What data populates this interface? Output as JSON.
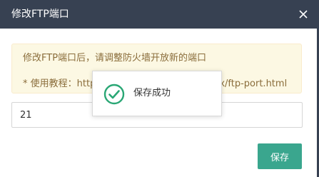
{
  "dialog": {
    "title": "修改FTP端口",
    "close_icon": "close-icon",
    "colors": {
      "titlebar_bg": "#374152",
      "notice_bg": "#fcf8e3",
      "notice_text": "#8a6d3b",
      "accent": "#3aa68e"
    }
  },
  "notice": {
    "line1": "修改FTP端口后，请调整防火墙开放新的端口",
    "line2_prefix": "* 使用教程：http",
    "line2_suffix": "x/ftp-port.html"
  },
  "form": {
    "port_value": "21"
  },
  "footer": {
    "save_label": "保存"
  },
  "toast": {
    "icon": "check-circle-icon",
    "message": "保存成功"
  }
}
